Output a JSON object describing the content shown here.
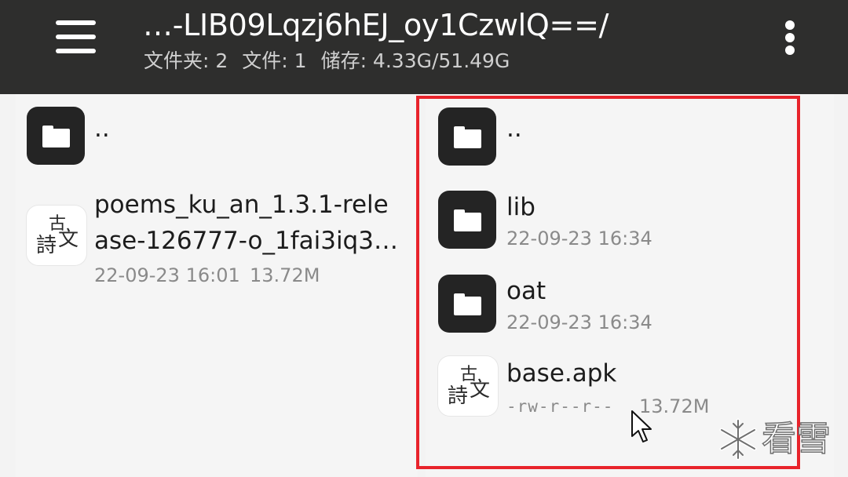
{
  "header": {
    "title": "…-LIB09Lqzj6hEJ_oy1CzwlQ==/",
    "folders_label": "文件夹: 2",
    "files_label": "文件: 1",
    "storage_label": "储存: 4.33G/51.49G",
    "menu_icon": "hamburger-menu-icon",
    "more_icon": "more-vert-icon"
  },
  "left_pane": {
    "items": [
      {
        "type": "folder",
        "name": "..",
        "icon": "folder-icon"
      },
      {
        "type": "file",
        "name_line1": "poems_ku_an_1.3.1-rele",
        "name_line2": "ase-126777-o_1fai3iq3…",
        "date": "22-09-23 16:01",
        "size": "13.72M",
        "icon": "app-icon",
        "icon_text": [
          "古",
          "詩",
          "文"
        ]
      }
    ]
  },
  "right_pane": {
    "items": [
      {
        "type": "folder",
        "name": "..",
        "icon": "folder-icon"
      },
      {
        "type": "folder",
        "name": "lib",
        "date": "22-09-23 16:34",
        "icon": "folder-icon"
      },
      {
        "type": "folder",
        "name": "oat",
        "date": "22-09-23 16:34",
        "icon": "folder-icon"
      },
      {
        "type": "file",
        "name": "base.apk",
        "permissions": "-rw-r--r--",
        "size": "13.72M",
        "icon": "app-icon",
        "icon_text": [
          "古",
          "詩",
          "文"
        ]
      }
    ]
  },
  "overlay": {
    "highlight_color": "#e8232b",
    "cursor_icon": "mouse-pointer-icon"
  },
  "watermark": {
    "text": "看雪",
    "icon": "snowflake-icon"
  }
}
